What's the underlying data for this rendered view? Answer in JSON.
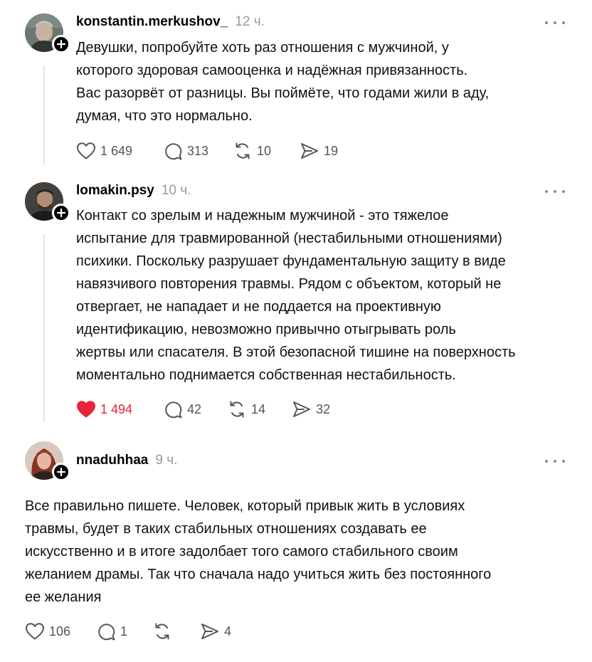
{
  "posts": [
    {
      "username": "konstantin.merkushov_",
      "time": "12 ч.",
      "text": "Девушки, попробуйте хоть раз отношения с мужчиной, у\nкоторого здоровая самооценка и надёжная привязанность.\nВас разорвёт от разницы. Вы поймёте, что годами жили в аду,\nдумая, что это нормально.",
      "likes": "1 649",
      "comments": "313",
      "reposts": "10",
      "shares": "19",
      "liked": false
    },
    {
      "username": "lomakin.psy",
      "time": "10 ч.",
      "text": "Контакт со зрелым и надежным мужчиной - это тяжелое\nиспытание для травмированной (нестабильными отношениями)\nпсихики. Поскольку разрушает фундаментальную защиту в виде\nнавязчивого повторения травмы. Рядом с объектом, который не\nотвергает, не нападает и не поддается на проективную\nидентификацию, невозможно привычно отыгрывать роль\nжертвы или спасателя. В этой безопасной тишине на поверхность\nмоментально поднимается собственная нестабильность.",
      "likes": "1 494",
      "comments": "42",
      "reposts": "14",
      "shares": "32",
      "liked": true
    },
    {
      "username": "nnaduhhaa",
      "time": "9 ч.",
      "text": "Все правильно пишете. Человек, который привык жить в условиях\nтравмы, будет в таких стабильных отношениях создавать ее\nискусственно и в итоге задолбает того самого стабильного своим\nжеланием драмы. Так что сначала надо учиться жить без постоянного\nее желания",
      "likes": "106",
      "comments": "1",
      "reposts": "",
      "shares": "4",
      "liked": false
    }
  ],
  "colors": {
    "like_active": "#e8233b",
    "meta_gray": "#9a9a9a",
    "icon_gray": "#555555",
    "thread_line": "#e4e4e4"
  },
  "icons": [
    "heart-icon",
    "comment-icon",
    "repost-icon",
    "share-icon",
    "more-icon",
    "follow-plus-icon"
  ]
}
